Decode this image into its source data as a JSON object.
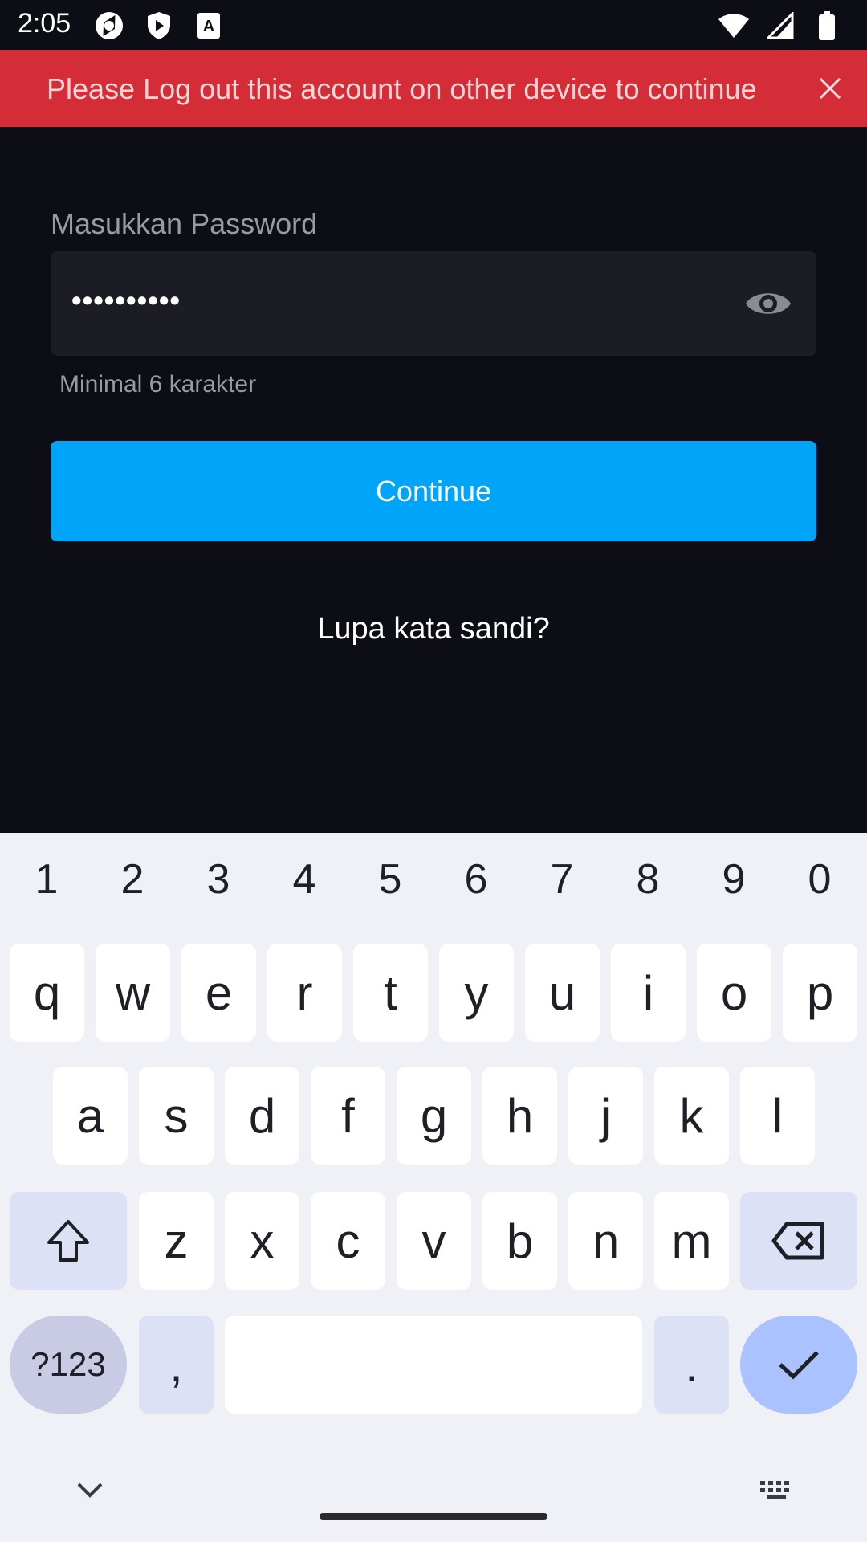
{
  "status_bar": {
    "time": "2:05"
  },
  "header": {
    "title": "Masukkan Password"
  },
  "banner": {
    "message": "Please Log out this account on other device to continue"
  },
  "form": {
    "label": "Masukkan Password",
    "password_value": "••••••••••",
    "helper": "Minimal 6 karakter",
    "continue_label": "Continue",
    "forgot_label": "Lupa kata sandi?"
  },
  "keyboard": {
    "numbers": [
      "1",
      "2",
      "3",
      "4",
      "5",
      "6",
      "7",
      "8",
      "9",
      "0"
    ],
    "row1": [
      "q",
      "w",
      "e",
      "r",
      "t",
      "y",
      "u",
      "i",
      "o",
      "p"
    ],
    "row2": [
      "a",
      "s",
      "d",
      "f",
      "g",
      "h",
      "j",
      "k",
      "l"
    ],
    "row3": [
      "z",
      "x",
      "c",
      "v",
      "b",
      "n",
      "m"
    ],
    "symbols_label": "?123",
    "comma": ",",
    "period": "."
  },
  "colors": {
    "banner": "#d42d37",
    "accent": "#00a4f8",
    "background": "#0d0d16",
    "keyboard_bg": "#f0f0f7"
  }
}
